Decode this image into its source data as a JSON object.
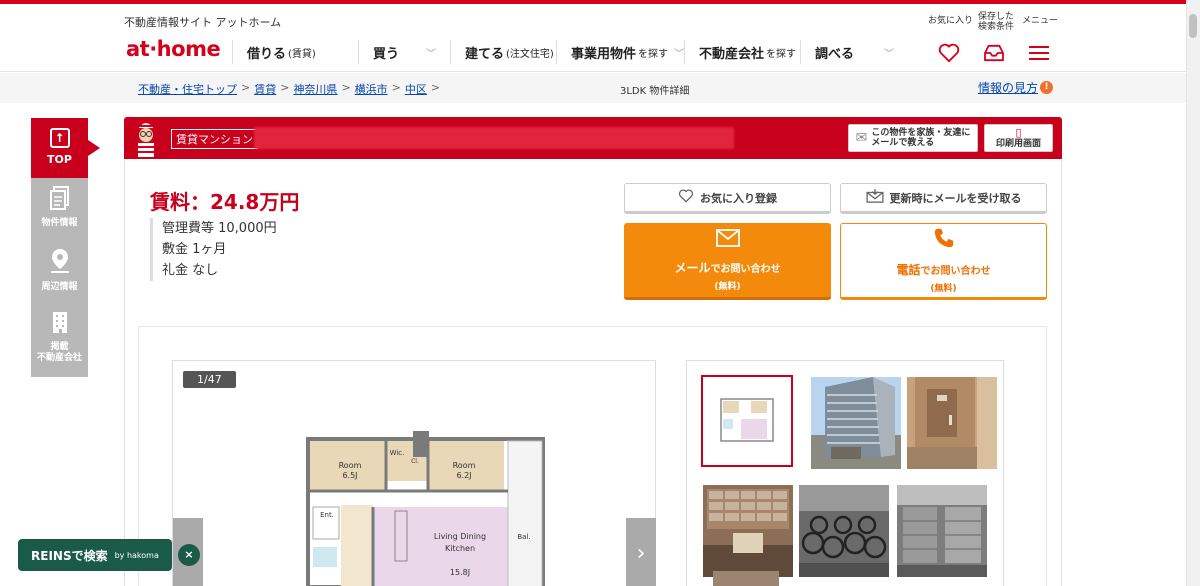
{
  "header": {
    "tagline": "不動産情報サイト アットホーム",
    "logo": "at·home",
    "nav": [
      {
        "label": "借りる",
        "sub": "(賃貸)"
      },
      {
        "label": "買う",
        "sub": ""
      },
      {
        "label": "建てる",
        "sub": "(注文住宅)"
      },
      {
        "label": "事業用物件",
        "sub": "を探す"
      },
      {
        "label": "不動産会社",
        "sub": "を探す"
      },
      {
        "label": "調べる",
        "sub": ""
      }
    ],
    "util": {
      "favorites": "お気に入り",
      "saved_line1": "保存した",
      "saved_line2": "検索条件",
      "menu": "メニュー"
    },
    "icons": [
      "heart-icon",
      "inbox-icon",
      "hamburger-icon"
    ]
  },
  "breadcrumb": {
    "items": [
      "不動産・住宅トップ",
      "賃貸",
      "神奈川県",
      "横浜市",
      "中区"
    ],
    "current": "3LDK 物件詳細",
    "guide": "情報の見方"
  },
  "sidenav": {
    "top": "TOP",
    "items": [
      {
        "label": "物件情報",
        "icon": "document-icon"
      },
      {
        "label": "周辺情報",
        "icon": "map-pin-icon"
      },
      {
        "label1": "掲載",
        "label2": "不動産会社",
        "icon": "building-icon"
      }
    ]
  },
  "listing": {
    "type_badge": "賃貸マンション",
    "share_btn_l1": "この物件を家族・友達に",
    "share_btn_l2": "メールで教える",
    "print_btn": "印刷用画面",
    "rent": "賃料：24.8万円",
    "costs": [
      "管理費等 10,000円",
      "敷金 1ヶ月",
      "礼金 なし"
    ],
    "actions": {
      "favorite": "お気に入り登録",
      "notify": "更新時にメールを受け取る",
      "email_l1_strong": "メール",
      "email_l1_rest": "でお問い合わせ",
      "email_l2": "(無料)",
      "tel_l1_strong": "電話",
      "tel_l1_rest": "でお問い合わせ",
      "tel_l2": "(無料)"
    },
    "gallery": {
      "counter": "1/47",
      "floorplan_labels": {
        "room1": "Room",
        "room1_size": "6.5J",
        "room2": "Room",
        "room2_size": "6.2J",
        "wic": "Wic.",
        "cl": "Cl.",
        "ent": "Ent.",
        "ldk1": "Living Dining",
        "ldk2": "Kitchen",
        "ldk_size": "15.8J",
        "bal": "Bal."
      }
    }
  },
  "reins": {
    "label": "REINSで検索",
    "by": "by hakoma",
    "close": "×"
  },
  "colors": {
    "brand_red": "#c8001c",
    "orange": "#f38a0c",
    "reins_green": "#195b46"
  }
}
